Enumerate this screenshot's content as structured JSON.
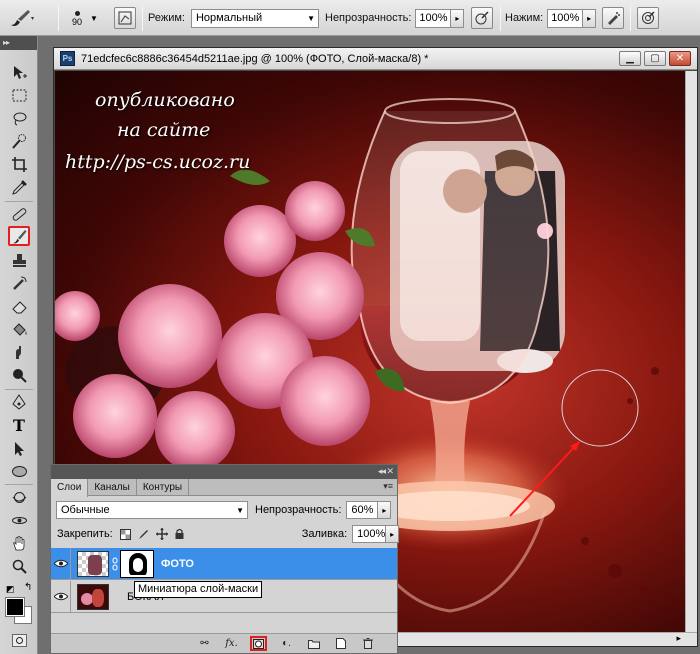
{
  "options_bar": {
    "brush_size": "90",
    "mode_label": "Режим:",
    "mode_value": "Нормальный",
    "opacity_label": "Непрозрачность:",
    "opacity_value": "100%",
    "flow_label": "Нажим:",
    "flow_value": "100%"
  },
  "document": {
    "title": "71edcfec6c8886c36454d5211ae.jpg @ 100% (ФОТО, Слой-маска/8) *",
    "badge": "Ps",
    "watermark_lines": [
      "опубликовано",
      "на сайте",
      "http://ps-cs.ucoz.ru"
    ]
  },
  "layers_panel": {
    "tabs": [
      {
        "label": "Слои"
      },
      {
        "label": "Каналы"
      },
      {
        "label": "Контуры"
      }
    ],
    "blend_mode": "Обычные",
    "opacity_label": "Непрозрачность:",
    "opacity_value": "60%",
    "lock_label": "Закрепить:",
    "fill_label": "Заливка:",
    "fill_value": "100%",
    "layers": [
      {
        "name": "ФОТО"
      },
      {
        "name": "БОКАЛ"
      }
    ],
    "tooltip": "Миниатюра слой-маски"
  },
  "colors": {
    "selection_blue": "#3b8fe8",
    "highlight_red": "#e02020"
  }
}
